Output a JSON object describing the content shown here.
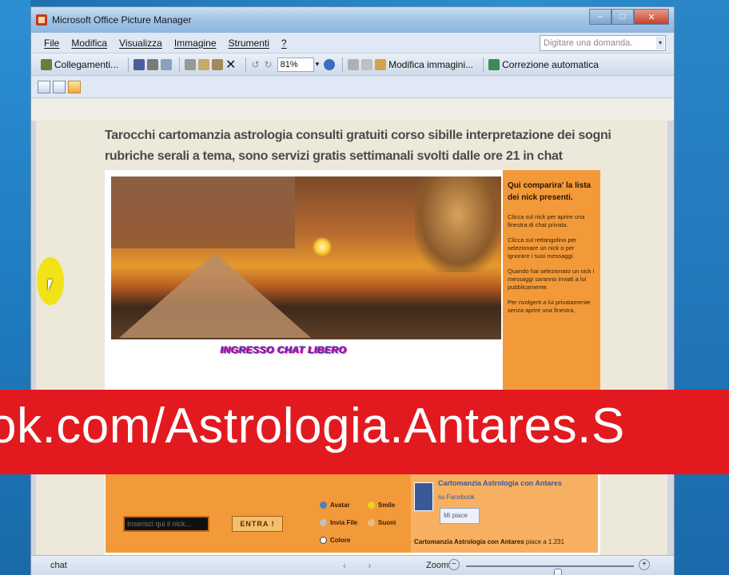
{
  "window": {
    "title": "Microsoft Office Picture Manager",
    "controls": {
      "minimize": "–",
      "maximize": "□",
      "close": "✕"
    }
  },
  "menu": {
    "items": [
      "File",
      "Modifica",
      "Visualizza",
      "Immagine",
      "Strumenti",
      "?"
    ],
    "help_placeholder": "Digitare una domanda."
  },
  "toolbar": {
    "shortcuts_label": "Collegamenti...",
    "zoom_value": "81%",
    "edit_pictures_label": "Modifica immagini...",
    "auto_correct_label": "Correzione automatica"
  },
  "page": {
    "title": "Tarocchi cartomanzia astrologia consulti gratuiti corso sibille interpretazione dei sogni rubriche serali a tema, sono servizi gratis settimanali svolti dalle ore 21 in chat",
    "enter_chat": "INGRESSO CHAT LIBERO",
    "sidebar": {
      "title": "Qui comparira' la lista dei nick presenti.",
      "p1": "Clicca sul nick per aprire una finestra di chat privata.",
      "p2": "Clicca sul rettangolino per selezionare un nick o per ignorare i suoi messaggi.",
      "p3": "Quando hai selezionato un nick i messaggi saranno inviati a lui pubblicamente.",
      "p4": "Per rivolgerti a lui privatamente senza aprire una finestra,"
    },
    "nick_placeholder": "Inserisci qui il nick...",
    "enter_button": "ENTRA !",
    "options": {
      "avatar": "Avatar",
      "smile": "Smile",
      "send_file": "Invia File",
      "sounds": "Suoni",
      "color": "Colore"
    },
    "facebook": {
      "name": "Cartomanzia Astrologia con Antares",
      "sub": "su Facebook",
      "like": "Mi piace",
      "footer_bold": "Cartomanzia Astrologia con Antares",
      "footer_rest": "piace a 1.231"
    }
  },
  "banner": {
    "text": "ok.com/Astrologia.Antares.S"
  },
  "statusbar": {
    "left": "chat",
    "zoom_label": "Zoom:",
    "zoom_level": 0.55
  },
  "colors": {
    "orange": "#f29a3a",
    "banner_red": "#e21a1f",
    "title_gray": "#4a4a4a"
  }
}
